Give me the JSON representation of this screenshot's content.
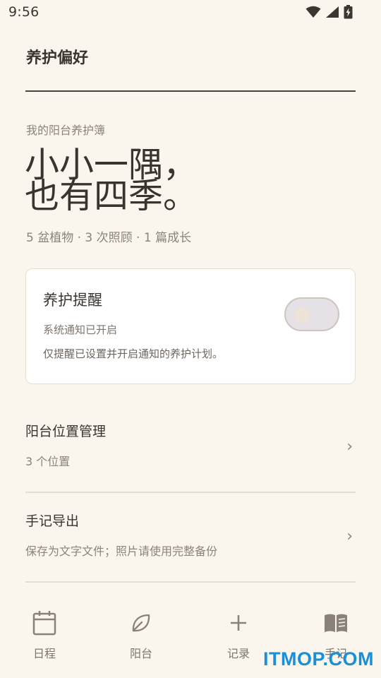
{
  "status_bar": {
    "time": "9:56"
  },
  "header": {
    "title": "养护偏好"
  },
  "intro": {
    "kicker": "我的阳台养护簿",
    "hero_line1": "小小一隅，",
    "hero_line2": "也有四季。",
    "stats": "5 盆植物 · 3 次照顾 · 1 篇成长"
  },
  "reminder": {
    "title": "养护提醒",
    "status": "系统通知已开启",
    "note": "仅提醒已设置并开启通知的养护计划。",
    "enabled": false
  },
  "rows": [
    {
      "title": "阳台位置管理",
      "subtitle": "3 个位置"
    },
    {
      "title": "手记导出",
      "subtitle": "保存为文字文件；照片请使用完整备份"
    }
  ],
  "nav": [
    {
      "label": "日程",
      "icon": "calendar-icon"
    },
    {
      "label": "阳台",
      "icon": "leaf-icon"
    },
    {
      "label": "记录",
      "icon": "plus-icon"
    },
    {
      "label": "手记",
      "icon": "book-icon"
    }
  ],
  "watermark": "ITMOP.COM",
  "colors": {
    "background": "#faf6ee",
    "text": "#3a3430",
    "muted": "#8b837b",
    "watermark": "#1a8fd6"
  }
}
